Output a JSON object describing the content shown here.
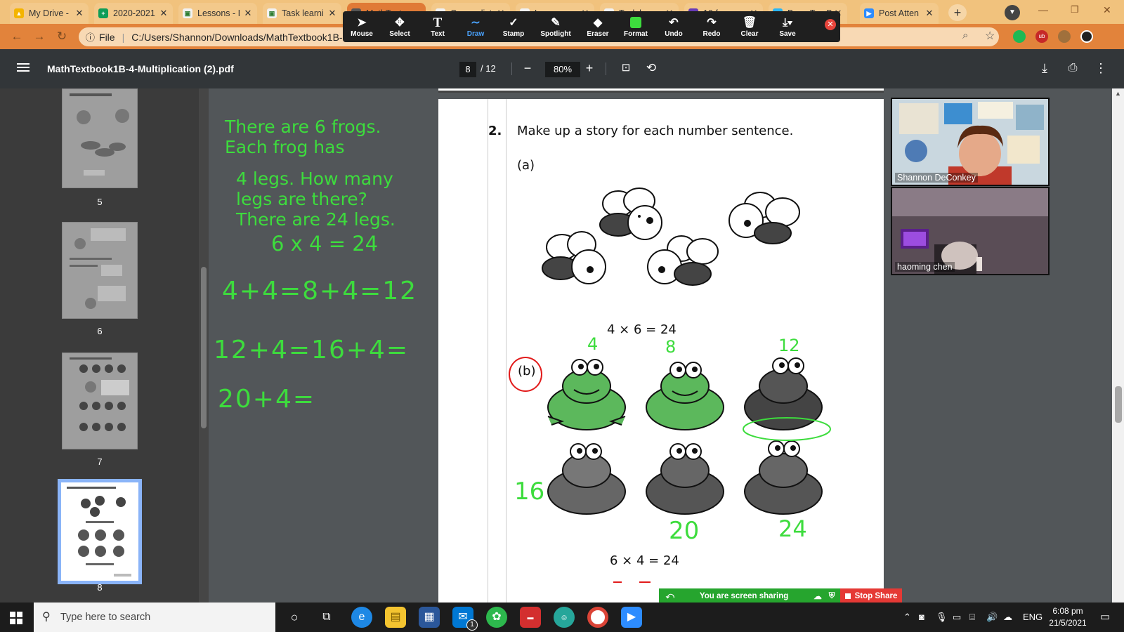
{
  "browser": {
    "tabs": [
      {
        "label": "My Drive -",
        "icon": "google-drive-icon"
      },
      {
        "label": "2020-2021",
        "icon": "google-sheets-icon"
      },
      {
        "label": "Lessons - I",
        "icon": "classroom-icon"
      },
      {
        "label": "Task learni",
        "icon": "classroom-icon"
      },
      {
        "label": "MathText",
        "icon": "pdf-icon"
      },
      {
        "label": "Course list",
        "icon": "classroom-icon"
      },
      {
        "label": "Lessons",
        "icon": "classroom-icon"
      },
      {
        "label": "Task learn",
        "icon": "classroom-icon"
      },
      {
        "label": "10 frames",
        "icon": "forms-icon"
      },
      {
        "label": "Base Ten B",
        "icon": "web-icon"
      },
      {
        "label": "Post Atten",
        "icon": "zoom-icon"
      }
    ],
    "address": {
      "scheme_label": "File",
      "url": "C:/Users/Shannon/Downloads/MathTextbook1B-4"
    }
  },
  "annotation_toolbar": {
    "tools": [
      {
        "label": "Mouse",
        "icon": "mouse-pointer-icon"
      },
      {
        "label": "Select",
        "icon": "move-icon"
      },
      {
        "label": "Text",
        "icon": "text-icon"
      },
      {
        "label": "Draw",
        "icon": "draw-squiggle-icon"
      },
      {
        "label": "Stamp",
        "icon": "checkmark-stamp-icon"
      },
      {
        "label": "Spotlight",
        "icon": "spotlight-wand-icon"
      },
      {
        "label": "Eraser",
        "icon": "eraser-icon"
      },
      {
        "label": "Format",
        "icon": "format-color-icon"
      },
      {
        "label": "Undo",
        "icon": "undo-icon"
      },
      {
        "label": "Redo",
        "icon": "redo-icon"
      },
      {
        "label": "Clear",
        "icon": "trash-icon"
      },
      {
        "label": "Save",
        "icon": "save-download-icon"
      }
    ],
    "active_tool": "Draw"
  },
  "pdf": {
    "title": "MathTextbook1B-4-Multiplication (2).pdf",
    "current_page": "8",
    "total_pages": "/ 12",
    "zoom": "80%",
    "thumbnails": [
      {
        "page": "5"
      },
      {
        "page": "6"
      },
      {
        "page": "7"
      },
      {
        "page": "8"
      }
    ]
  },
  "annotations": {
    "story_line1": "There are 6 frogs.",
    "story_line2": "Each frog has",
    "story_line3": "4 legs.  How many",
    "story_line4": "legs are there?",
    "story_line5": "There are 24 legs.",
    "equation": "6 x 4 = 24",
    "sum1": "4+4=8+4=12",
    "sum2": "12+4=16+4=",
    "sum3": "20+4=",
    "count_4": "4",
    "count_8": "8",
    "count_12": "12",
    "count_16": "16",
    "count_20": "20",
    "count_24": "24"
  },
  "document": {
    "question_number": "2.",
    "question_text": "Make up a story for each number sentence.",
    "part_a": "(a)",
    "sentence_a": "4  ×  6  =  24",
    "part_b": "(b)",
    "sentence_b": "6  ×  4  =  24"
  },
  "video": {
    "participants": [
      {
        "name": "Shannon DeConkey"
      },
      {
        "name": "haoming chen"
      }
    ]
  },
  "share": {
    "status": "You are screen sharing",
    "stop_label": "Stop Share"
  },
  "taskbar": {
    "search_placeholder": "Type here to search",
    "language": "ENG",
    "time": "6:08 pm",
    "date": "21/5/2021",
    "mail_badge": "1"
  },
  "colors": {
    "annotation_green": "#3ddc3d",
    "frog_green": "#5cb85c",
    "tab_strip": "#f1c27d",
    "share_green": "#26a52e",
    "stop_red": "#e53935"
  }
}
